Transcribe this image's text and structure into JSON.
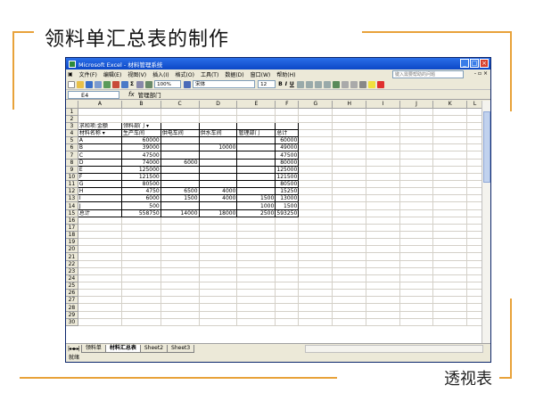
{
  "slide": {
    "title": "领料单汇总表的制作",
    "footer": "透视表"
  },
  "window": {
    "title": "Microsoft Excel - 材料管理系统"
  },
  "menu": {
    "items": [
      "文件(F)",
      "编辑(E)",
      "视图(V)",
      "插入(I)",
      "格式(O)",
      "工具(T)",
      "数据(D)",
      "窗口(W)",
      "帮助(H)"
    ],
    "help_placeholder": "键入需要帮助的问题",
    "doc_controls": "- ▫ ×"
  },
  "toolbar": {
    "zoom": "100%",
    "font": "宋体",
    "font_size": "12",
    "bold": "B",
    "italic": "I",
    "underline": "U"
  },
  "formula_bar": {
    "cell_ref": "E4",
    "fx": "fx",
    "content": "管理部门"
  },
  "columns": [
    "A",
    "B",
    "C",
    "D",
    "E",
    "F",
    "G",
    "H",
    "I",
    "J",
    "K",
    "L"
  ],
  "rows": [
    [
      "",
      "",
      "",
      "",
      "",
      ""
    ],
    [
      "",
      "",
      "",
      "",
      "",
      ""
    ],
    [
      "求和项:金额",
      "领料部门 ▾",
      "",
      "",
      "",
      ""
    ],
    [
      "材料名称 ▾",
      "生产车间",
      "供电车间",
      "供水车间",
      "管理部门",
      "总计"
    ],
    [
      "A",
      "60000",
      "",
      "",
      "",
      "60000"
    ],
    [
      "B",
      "39000",
      "",
      "10000",
      "",
      "49000"
    ],
    [
      "C",
      "47500",
      "",
      "",
      "",
      "47500"
    ],
    [
      "D",
      "74000",
      "6000",
      "",
      "",
      "80000"
    ],
    [
      "E",
      "125000",
      "",
      "",
      "",
      "125000"
    ],
    [
      "F",
      "121500",
      "",
      "",
      "",
      "121500"
    ],
    [
      "G",
      "80500",
      "",
      "",
      "",
      "80500"
    ],
    [
      "H",
      "4750",
      "6500",
      "4000",
      "",
      "15250"
    ],
    [
      "I",
      "6000",
      "1500",
      "4000",
      "1500",
      "13000"
    ],
    [
      "J",
      "500",
      "",
      "",
      "1000",
      "1500"
    ],
    [
      "总计",
      "558750",
      "14000",
      "18000",
      "2500",
      "593250"
    ]
  ],
  "row_count": 30,
  "sheet_tabs": [
    "领料单",
    "材料汇总表",
    "Sheet2",
    "Sheet3"
  ],
  "active_tab": "材料汇总表",
  "status": "就绪"
}
